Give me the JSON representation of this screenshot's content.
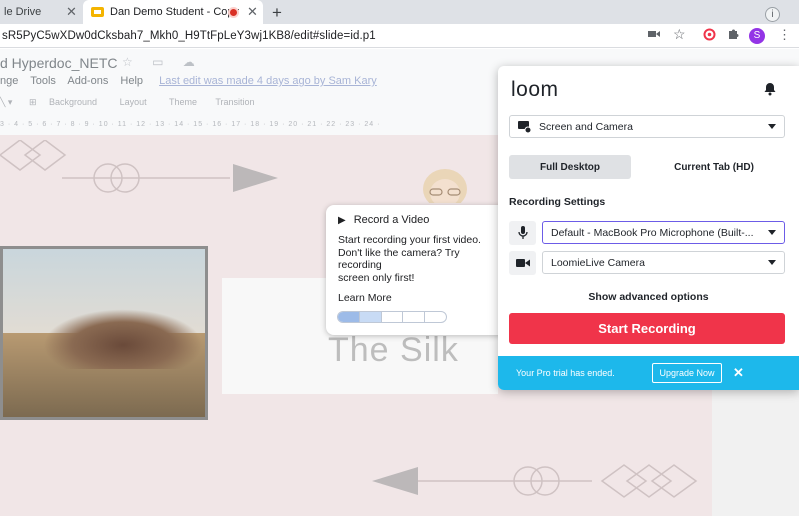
{
  "browser": {
    "tabs": [
      {
        "label": "le Drive",
        "close": "✕"
      },
      {
        "label": "Dan Demo Student - Copy",
        "close": "✕"
      }
    ],
    "new_tab": "+",
    "url": "sR5PyC5wXDw0dCksbah7_Mkh0_H9TtFpLeY3wj1KB8/edit#slide=id.p1",
    "profile_initial": "S"
  },
  "slides": {
    "doc_title": "d Hyperdoc_NETC",
    "menu": [
      "nge",
      "Tools",
      "Add-ons",
      "Help"
    ],
    "last_edit": "Last edit was made 4 days ago by Sam Kary",
    "toolbar": [
      "Background",
      "Layout",
      "Theme",
      "Transition"
    ],
    "ruler": "3 · 4 · 5 · 6 · 7 · 8 · 9 · 10 · 11 · 12 · 13 · 14 · 15 · 16 · 17 · 18 · 19 · 20 · 21 · 22 · 23 · 24 ·",
    "slide_text": "The Silk"
  },
  "tooltip": {
    "title": "Record a Video",
    "body_lines": [
      "Start recording your first video.",
      "Don't like the camera? Try",
      "recording",
      "screen only first!"
    ],
    "link": "Learn More",
    "progress_steps": 5,
    "progress_done": 1,
    "progress_current": 2
  },
  "loom": {
    "logo": "loom",
    "capture_mode": "Screen and Camera",
    "tabs": [
      "Full Desktop",
      "Current Tab (HD)"
    ],
    "active_tab": "Full Desktop",
    "settings_label": "Recording Settings",
    "microphone": "Default - MacBook Pro Microphone (Built-...",
    "camera": "LoomieLive Camera",
    "advanced": "Show advanced options",
    "start_button": "Start Recording",
    "trial_text": "Your Pro trial has ended.",
    "upgrade_button": "Upgrade Now",
    "close": "✕"
  },
  "colors": {
    "loom_red": "#f0344a",
    "trial_blue": "#1db8eb",
    "chrome_bg": "#dee1e6",
    "slide_bg": "#f1e6e7"
  }
}
